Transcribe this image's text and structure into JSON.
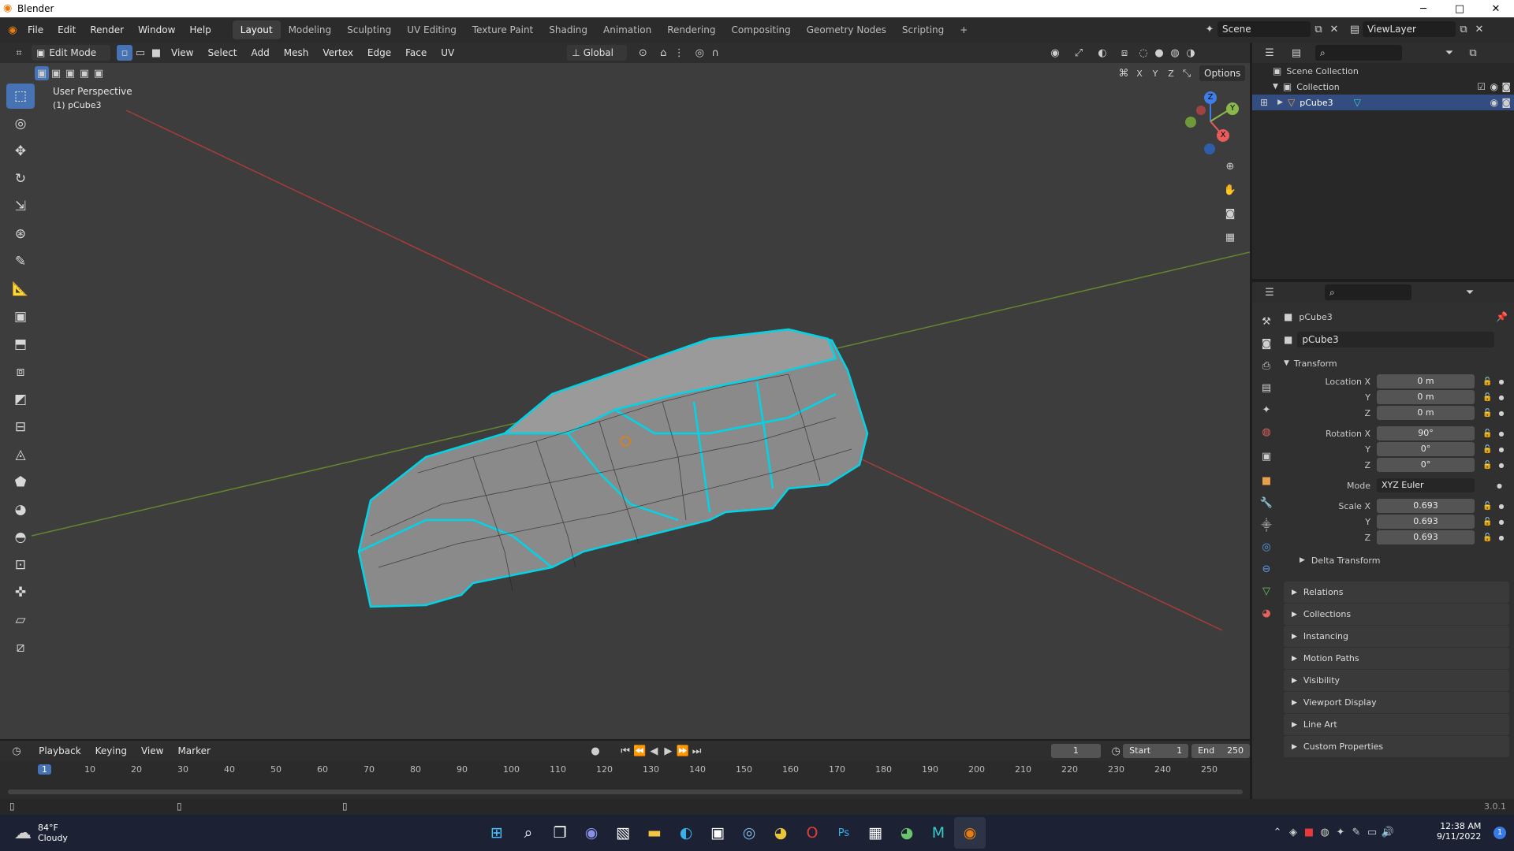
{
  "titlebar": {
    "title": "Blender",
    "min": "─",
    "max": "□",
    "close": "✕"
  },
  "menubar": {
    "menus": [
      "File",
      "Edit",
      "Render",
      "Window",
      "Help"
    ],
    "workspaces": [
      "Layout",
      "Modeling",
      "Sculpting",
      "UV Editing",
      "Texture Paint",
      "Shading",
      "Animation",
      "Rendering",
      "Compositing",
      "Geometry Nodes",
      "Scripting"
    ],
    "add_tab": "+",
    "scene": "Scene",
    "view_layer": "ViewLayer"
  },
  "viewport_header": {
    "mode": "Edit Mode",
    "menus": [
      "View",
      "Select",
      "Add",
      "Mesh",
      "Vertex",
      "Edge",
      "Face",
      "UV"
    ],
    "orientation": "Global",
    "options": "Options",
    "axes": [
      "X",
      "Y",
      "Z"
    ]
  },
  "viewport": {
    "view_name": "User Perspective",
    "object_label": "(1) pCube3",
    "gizmo": {
      "z": "Z",
      "y": "Y",
      "x": "X"
    }
  },
  "outliner": {
    "scene_collection": "Scene Collection",
    "collection": "Collection",
    "object": "pCube3"
  },
  "properties": {
    "object_name": "pCube3",
    "data_name": "pCube3",
    "transform_label": "Transform",
    "location": {
      "label_x": "Location X",
      "x": "0 m",
      "y": "0 m",
      "z": "0 m"
    },
    "rotation": {
      "label_x": "Rotation X",
      "x": "90°",
      "y": "0°",
      "z": "0°"
    },
    "mode_label": "Mode",
    "mode_value": "XYZ Euler",
    "scale": {
      "label_x": "Scale X",
      "x": "0.693",
      "y": "0.693",
      "z": "0.693"
    },
    "axis_y": "Y",
    "axis_z": "Z",
    "delta_transform": "Delta Transform",
    "panels": [
      "Relations",
      "Collections",
      "Instancing",
      "Motion Paths",
      "Visibility",
      "Viewport Display",
      "Line Art",
      "Custom Properties"
    ]
  },
  "timeline": {
    "menus": [
      "Playback",
      "Keying",
      "View",
      "Marker"
    ],
    "current_frame": "1",
    "start_label": "Start",
    "start": "1",
    "end_label": "End",
    "end": "250",
    "ticks": [
      "1",
      "10",
      "20",
      "30",
      "40",
      "50",
      "60",
      "70",
      "80",
      "90",
      "100",
      "110",
      "120",
      "130",
      "140",
      "150",
      "160",
      "170",
      "180",
      "190",
      "200",
      "210",
      "220",
      "230",
      "240",
      "250"
    ]
  },
  "statusbar": {
    "version": "3.0.1"
  },
  "taskbar": {
    "weather_temp": "84°F",
    "weather_desc": "Cloudy",
    "time": "12:38 AM",
    "date": "9/11/2022",
    "notification_count": "1"
  },
  "colors": {
    "accent": "#4772b3",
    "edge_select": "#00d4e6",
    "x_axis": "#c23b3b",
    "y_axis": "#6c9a2c",
    "viewport_bg": "#3d3d3d"
  }
}
